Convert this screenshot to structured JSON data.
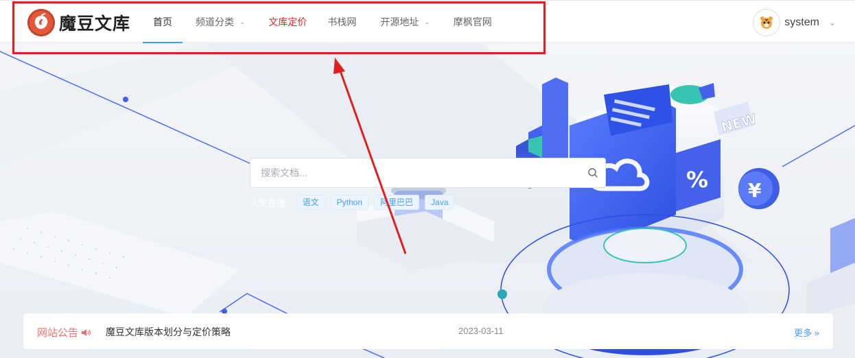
{
  "brand": {
    "name": "魔豆文库",
    "accent": "#e2593a"
  },
  "nav": {
    "items": [
      {
        "label": "首页",
        "dropdown": false,
        "active": true
      },
      {
        "label": "频道分类",
        "dropdown": true
      },
      {
        "label": "文库定价",
        "dropdown": false,
        "color": "#d52b2b"
      },
      {
        "label": "书栈网",
        "dropdown": false
      },
      {
        "label": "开源地址",
        "dropdown": true
      },
      {
        "label": "摩枫官网",
        "dropdown": false
      }
    ],
    "active_underline_color": "#409eff"
  },
  "user": {
    "name": "system",
    "avatar_icon": "tiger-avatar-icon"
  },
  "search": {
    "placeholder": "搜索文档..."
  },
  "hot": {
    "label": "大家在搜:",
    "tags": [
      "语文",
      "Python",
      "阿里巴巴",
      "Java"
    ]
  },
  "notice": {
    "title": "网站公告",
    "text": "魔豆文库版本划分与定价策略",
    "date": "2023-03-11",
    "more": "更多 »"
  },
  "annotation": {
    "color": "#e21f1f"
  },
  "hero": {
    "badge_text": "NEW"
  }
}
